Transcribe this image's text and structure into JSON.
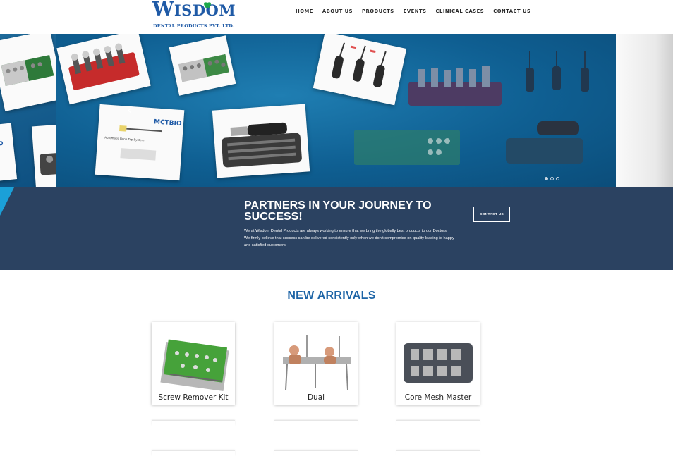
{
  "brand": {
    "logo_main": "ISDOM",
    "logo_initial": "W",
    "logo_sub": "DENTAL PRODUCTS PVT. LTD."
  },
  "nav": {
    "items": [
      "HOME",
      "ABOUT US",
      "PRODUCTS",
      "EVENTS",
      "CLINICAL CASES",
      "CONTACT US"
    ]
  },
  "slider": {
    "slide_count": 3,
    "active_slide": 0,
    "card_text": "MCTBIO",
    "card_sub": "Automatic Bone Tap System"
  },
  "banner": {
    "title": "PARTNERS IN YOUR JOURNEY TO SUCCESS!",
    "line1": "We at Wisdom Dental Products are always working to ensure that we bring the globally best products to our Doctors.",
    "line2": "We firmly believe that success can be delivered consistently only when we don’t compromise on quality leading to happy and satisfied customers.",
    "button": "CONTACT US"
  },
  "new_arrivals": {
    "title": "NEW ARRIVALS",
    "products": [
      {
        "name": "Screw Remover Kit"
      },
      {
        "name": "Dual"
      },
      {
        "name": "Core Mesh Master"
      }
    ]
  },
  "colors": {
    "brand_blue": "#1f5aa6",
    "banner_bg": "#2b4261",
    "slider_bg": "#0f5f92",
    "heading_blue": "#1d64a6"
  }
}
